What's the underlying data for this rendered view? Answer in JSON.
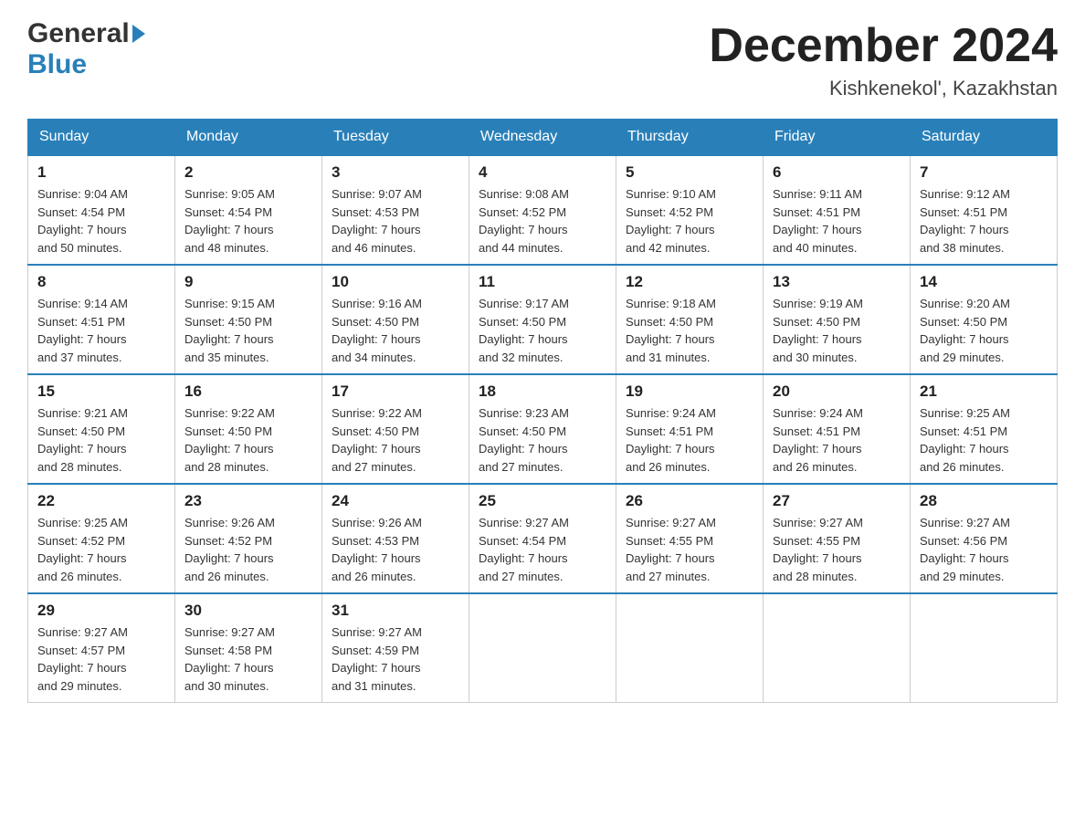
{
  "header": {
    "logo_general": "General",
    "logo_blue": "Blue",
    "month_title": "December 2024",
    "location": "Kishkenekol', Kazakhstan"
  },
  "weekdays": [
    "Sunday",
    "Monday",
    "Tuesday",
    "Wednesday",
    "Thursday",
    "Friday",
    "Saturday"
  ],
  "weeks": [
    [
      {
        "day": "1",
        "sunrise": "9:04 AM",
        "sunset": "4:54 PM",
        "daylight": "7 hours and 50 minutes."
      },
      {
        "day": "2",
        "sunrise": "9:05 AM",
        "sunset": "4:54 PM",
        "daylight": "7 hours and 48 minutes."
      },
      {
        "day": "3",
        "sunrise": "9:07 AM",
        "sunset": "4:53 PM",
        "daylight": "7 hours and 46 minutes."
      },
      {
        "day": "4",
        "sunrise": "9:08 AM",
        "sunset": "4:52 PM",
        "daylight": "7 hours and 44 minutes."
      },
      {
        "day": "5",
        "sunrise": "9:10 AM",
        "sunset": "4:52 PM",
        "daylight": "7 hours and 42 minutes."
      },
      {
        "day": "6",
        "sunrise": "9:11 AM",
        "sunset": "4:51 PM",
        "daylight": "7 hours and 40 minutes."
      },
      {
        "day": "7",
        "sunrise": "9:12 AM",
        "sunset": "4:51 PM",
        "daylight": "7 hours and 38 minutes."
      }
    ],
    [
      {
        "day": "8",
        "sunrise": "9:14 AM",
        "sunset": "4:51 PM",
        "daylight": "7 hours and 37 minutes."
      },
      {
        "day": "9",
        "sunrise": "9:15 AM",
        "sunset": "4:50 PM",
        "daylight": "7 hours and 35 minutes."
      },
      {
        "day": "10",
        "sunrise": "9:16 AM",
        "sunset": "4:50 PM",
        "daylight": "7 hours and 34 minutes."
      },
      {
        "day": "11",
        "sunrise": "9:17 AM",
        "sunset": "4:50 PM",
        "daylight": "7 hours and 32 minutes."
      },
      {
        "day": "12",
        "sunrise": "9:18 AM",
        "sunset": "4:50 PM",
        "daylight": "7 hours and 31 minutes."
      },
      {
        "day": "13",
        "sunrise": "9:19 AM",
        "sunset": "4:50 PM",
        "daylight": "7 hours and 30 minutes."
      },
      {
        "day": "14",
        "sunrise": "9:20 AM",
        "sunset": "4:50 PM",
        "daylight": "7 hours and 29 minutes."
      }
    ],
    [
      {
        "day": "15",
        "sunrise": "9:21 AM",
        "sunset": "4:50 PM",
        "daylight": "7 hours and 28 minutes."
      },
      {
        "day": "16",
        "sunrise": "9:22 AM",
        "sunset": "4:50 PM",
        "daylight": "7 hours and 28 minutes."
      },
      {
        "day": "17",
        "sunrise": "9:22 AM",
        "sunset": "4:50 PM",
        "daylight": "7 hours and 27 minutes."
      },
      {
        "day": "18",
        "sunrise": "9:23 AM",
        "sunset": "4:50 PM",
        "daylight": "7 hours and 27 minutes."
      },
      {
        "day": "19",
        "sunrise": "9:24 AM",
        "sunset": "4:51 PM",
        "daylight": "7 hours and 26 minutes."
      },
      {
        "day": "20",
        "sunrise": "9:24 AM",
        "sunset": "4:51 PM",
        "daylight": "7 hours and 26 minutes."
      },
      {
        "day": "21",
        "sunrise": "9:25 AM",
        "sunset": "4:51 PM",
        "daylight": "7 hours and 26 minutes."
      }
    ],
    [
      {
        "day": "22",
        "sunrise": "9:25 AM",
        "sunset": "4:52 PM",
        "daylight": "7 hours and 26 minutes."
      },
      {
        "day": "23",
        "sunrise": "9:26 AM",
        "sunset": "4:52 PM",
        "daylight": "7 hours and 26 minutes."
      },
      {
        "day": "24",
        "sunrise": "9:26 AM",
        "sunset": "4:53 PM",
        "daylight": "7 hours and 26 minutes."
      },
      {
        "day": "25",
        "sunrise": "9:27 AM",
        "sunset": "4:54 PM",
        "daylight": "7 hours and 27 minutes."
      },
      {
        "day": "26",
        "sunrise": "9:27 AM",
        "sunset": "4:55 PM",
        "daylight": "7 hours and 27 minutes."
      },
      {
        "day": "27",
        "sunrise": "9:27 AM",
        "sunset": "4:55 PM",
        "daylight": "7 hours and 28 minutes."
      },
      {
        "day": "28",
        "sunrise": "9:27 AM",
        "sunset": "4:56 PM",
        "daylight": "7 hours and 29 minutes."
      }
    ],
    [
      {
        "day": "29",
        "sunrise": "9:27 AM",
        "sunset": "4:57 PM",
        "daylight": "7 hours and 29 minutes."
      },
      {
        "day": "30",
        "sunrise": "9:27 AM",
        "sunset": "4:58 PM",
        "daylight": "7 hours and 30 minutes."
      },
      {
        "day": "31",
        "sunrise": "9:27 AM",
        "sunset": "4:59 PM",
        "daylight": "7 hours and 31 minutes."
      },
      null,
      null,
      null,
      null
    ]
  ],
  "labels": {
    "sunrise": "Sunrise:",
    "sunset": "Sunset:",
    "daylight": "Daylight:"
  }
}
